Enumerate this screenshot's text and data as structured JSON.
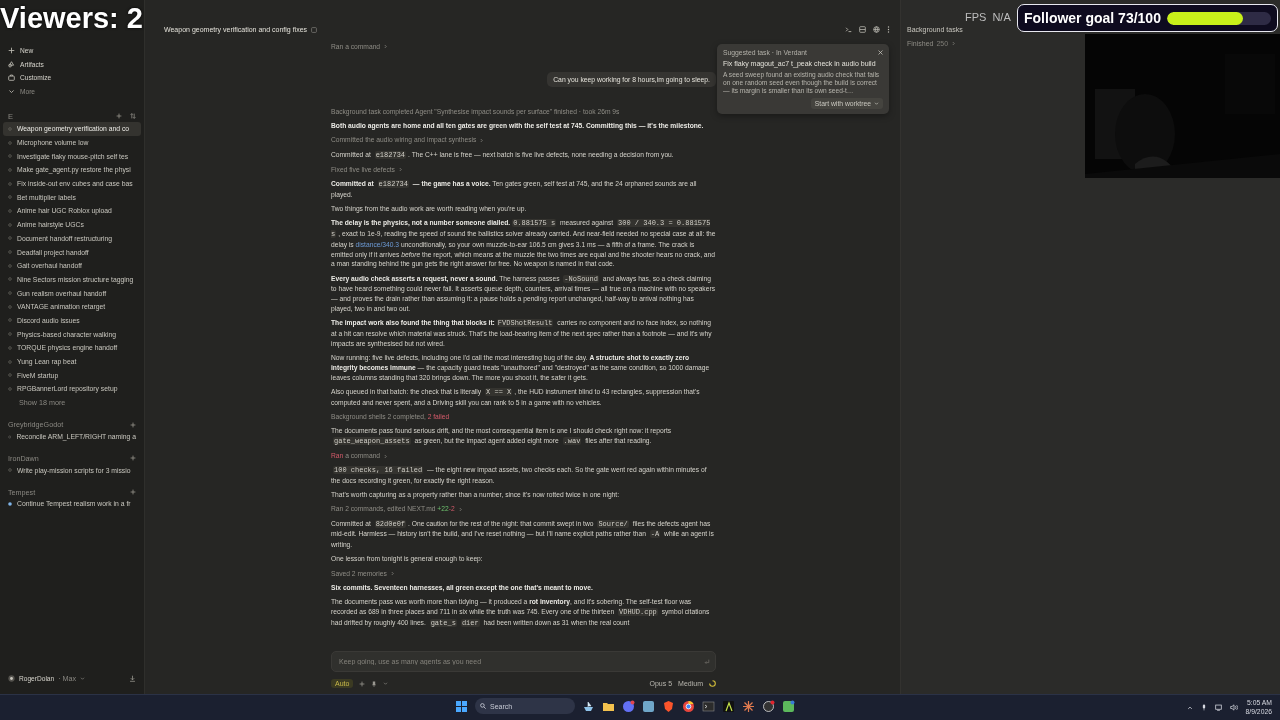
{
  "overlay": {
    "viewers": "Viewers: 2",
    "fps_label": "FPS",
    "fps_value": "N/A",
    "follower_goal": {
      "label": "Follower goal 73/100",
      "level": 0.73
    }
  },
  "sidebar": {
    "nav": [
      {
        "label": "New",
        "kind": "new"
      },
      {
        "label": "Artifacts",
        "kind": "artifacts"
      },
      {
        "label": "Customize",
        "kind": "customize"
      },
      {
        "label": "More",
        "kind": "more"
      }
    ],
    "section": "E",
    "chats": [
      {
        "title": "Weapon geometry verification and co",
        "selected": true
      },
      {
        "title": "Microphone volume low",
        "selected": false
      },
      {
        "title": "Investigate flaky mouse-pitch self tes",
        "selected": false
      },
      {
        "title": "Make gate_agent.py restore the physi",
        "selected": false
      },
      {
        "title": "Fix inside-out env cubes and case bas",
        "selected": false
      },
      {
        "title": "Bet multiplier labels",
        "selected": false
      },
      {
        "title": "Anime hair UGC Roblox upload",
        "selected": false
      },
      {
        "title": "Anime hairstyle UGCs",
        "selected": false
      },
      {
        "title": "Document handoff restructuring",
        "selected": false
      },
      {
        "title": "Deadfall project handoff",
        "selected": false
      },
      {
        "title": "Gait overhaul handoff",
        "selected": false
      },
      {
        "title": "Nine Sectors mission structure tagging",
        "selected": false
      },
      {
        "title": "Gun realism overhaul handoff",
        "selected": false
      },
      {
        "title": "VANTAGE animation retarget",
        "selected": false
      },
      {
        "title": "Discord audio issues",
        "selected": false
      },
      {
        "title": "Physics-based character walking",
        "selected": false
      },
      {
        "title": "TORQUE physics engine handoff",
        "selected": false
      },
      {
        "title": "Yung Lean rap beat",
        "selected": false
      },
      {
        "title": "FiveM startup",
        "selected": false
      },
      {
        "title": "RPGBannerLord repository setup",
        "selected": false
      }
    ],
    "show_more": "Show 18 more",
    "groups": [
      {
        "name": "GreybridgeGodot",
        "items": [
          {
            "title": "Reconcile ARM_LEFT/RIGHT naming a",
            "running": false
          }
        ]
      },
      {
        "name": "IronDawn",
        "items": [
          {
            "title": "Write play-mission scripts for 3 missio",
            "running": false
          }
        ]
      },
      {
        "name": "Tempest",
        "items": [
          {
            "title": "Continue Tempest realism work in a fr",
            "running": true
          }
        ]
      }
    ],
    "user": {
      "name": "RogerDolan",
      "plan": "· Max"
    }
  },
  "header": {
    "title": "Weapon geometry verification and config fixes"
  },
  "chat": {
    "blocks": [
      {
        "kind": "status",
        "expandable": true,
        "segments": [
          {
            "kind": "plain",
            "text": "Ran a command"
          }
        ]
      },
      {
        "kind": "user",
        "text": "Can you keep working for 8 hours,im going to sleep."
      },
      {
        "kind": "note",
        "text": "Background task completed Agent \"Synthesise impact sounds per surface\" finished · took 26m 9s"
      },
      {
        "kind": "paragraph",
        "segments": [
          {
            "kind": "bold",
            "text": "Both audio agents are home and all ten gates are green with the self test at 745. Committing this — it's the milestone."
          }
        ]
      },
      {
        "kind": "status",
        "expandable": true,
        "segments": [
          {
            "kind": "plain",
            "text": "Committed the audio wiring and impact synthesis"
          }
        ]
      },
      {
        "kind": "paragraph",
        "segments": [
          {
            "kind": "plain",
            "text": "Committed at "
          },
          {
            "kind": "code",
            "text": "e182734"
          },
          {
            "kind": "plain",
            "text": ". The C++ lane is free — next batch is five live defects, none needing a decision from you."
          }
        ]
      },
      {
        "kind": "status",
        "expandable": true,
        "segments": [
          {
            "kind": "plain",
            "text": "Fixed five live defects"
          }
        ]
      },
      {
        "kind": "paragraph",
        "segments": [
          {
            "kind": "bold",
            "text": "Committed at "
          },
          {
            "kind": "code",
            "text": "e182734"
          },
          {
            "kind": "bold",
            "text": " — the game has a voice."
          },
          {
            "kind": "plain",
            "text": " Ten gates green, self test at 745, and the 24 orphaned sounds are all played."
          }
        ]
      },
      {
        "kind": "paragraph",
        "segments": [
          {
            "kind": "plain",
            "text": "Two things from the audio work are worth reading when you're up."
          }
        ]
      },
      {
        "kind": "paragraph",
        "segments": [
          {
            "kind": "bold",
            "text": "The delay is the physics, not a number someone dialled."
          },
          {
            "kind": "code",
            "text": "0.881575 s"
          },
          {
            "kind": "plain",
            "text": " measured against "
          },
          {
            "kind": "code",
            "text": "300 / 340.3 = 0.881575 s"
          },
          {
            "kind": "plain",
            "text": ", exact to 1e-9, reading the speed of sound the ballistics solver already carried. And near-field needed no special case at all: the delay is "
          },
          {
            "kind": "link",
            "text": "distance/340.3"
          },
          {
            "kind": "plain",
            "text": " unconditionally, so your own muzzle-to-ear 106.5 cm gives 3.1 ms — a fifth of a frame. The crack is emitted only if it arrives "
          },
          {
            "kind": "italic",
            "text": "before"
          },
          {
            "kind": "plain",
            "text": " the report, which means at the muzzle the two times are equal and the shooter hears no crack, and a man standing behind the gun gets the right answer for free. No weapon is named in that code."
          }
        ]
      },
      {
        "kind": "paragraph",
        "segments": [
          {
            "kind": "bold",
            "text": "Every audio check asserts a request, never a sound."
          },
          {
            "kind": "plain",
            "text": " The harness passes "
          },
          {
            "kind": "code",
            "text": "-NoSound"
          },
          {
            "kind": "plain",
            "text": " and always has, so a check claiming to have heard something could never fail. It asserts queue depth, counters, arrival times — all true on a machine with no speakers — and proves the drain rather than assuming it: a pause holds a pending report unchanged, half-way to arrival nothing has played, two in and two out."
          }
        ]
      },
      {
        "kind": "paragraph",
        "segments": [
          {
            "kind": "bold",
            "text": "The impact work also found the thing that blocks it:"
          },
          {
            "kind": "code",
            "text": "FVDShotResult"
          },
          {
            "kind": "plain",
            "text": " carries no component and no face index, so nothing at a hit can resolve which material was struck. That's the load-bearing item of the next spec rather than a footnote — and it's why impacts are synthesised but not wired."
          }
        ]
      },
      {
        "kind": "paragraph",
        "segments": [
          {
            "kind": "plain",
            "text": "Now running: five live defects, including one I'd call the most interesting bug of the day. "
          },
          {
            "kind": "bold",
            "text": "A structure shot to exactly zero integrity becomes immune"
          },
          {
            "kind": "plain",
            "text": " — the capacity guard treats \"unauthored\" and \"destroyed\" as the same condition, so 1000 damage leaves columns standing that 320 brings down. The more you shoot it, the safer it gets."
          }
        ]
      },
      {
        "kind": "paragraph",
        "segments": [
          {
            "kind": "plain",
            "text": "Also queued in that batch: the check that is literally "
          },
          {
            "kind": "code",
            "text": "X == X"
          },
          {
            "kind": "plain",
            "text": ", the HUD instrument blind to 43 rectangles, suppression that's computed and never spent, and a Driving skill you can rank to 5 in a game with no vehicles."
          }
        ]
      },
      {
        "kind": "status",
        "expandable": false,
        "segments": [
          {
            "kind": "plain",
            "text": "Background shells 2 completed, "
          },
          {
            "kind": "red",
            "text": "2 failed"
          }
        ]
      },
      {
        "kind": "paragraph",
        "segments": [
          {
            "kind": "plain",
            "text": "The documents pass found serious drift, and the most consequential item is one I should check right now: it reports "
          },
          {
            "kind": "code",
            "text": "gate_weapon_assets"
          },
          {
            "kind": "plain",
            "text": " as green, but the impact agent added eight more "
          },
          {
            "kind": "code",
            "text": ".wav"
          },
          {
            "kind": "plain",
            "text": " files after that reading."
          }
        ]
      },
      {
        "kind": "status",
        "expandable": true,
        "segments": [
          {
            "kind": "red",
            "text": "Ran"
          },
          {
            "kind": "plain",
            "text": " a command"
          }
        ]
      },
      {
        "kind": "paragraph",
        "segments": [
          {
            "kind": "code",
            "text": "100 checks, 16 failed"
          },
          {
            "kind": "plain",
            "text": " — the eight new impact assets, two checks each. So the gate went red again within minutes of the docs recording it green, for exactly the right reason."
          }
        ]
      },
      {
        "kind": "paragraph",
        "segments": [
          {
            "kind": "plain",
            "text": "That's worth capturing as a property rather than a number, since it's now rotted twice in one night:"
          }
        ]
      },
      {
        "kind": "status",
        "expandable": true,
        "segments": [
          {
            "kind": "plain",
            "text": "Ran 2 commands, edited NEXT.md "
          },
          {
            "kind": "green",
            "text": "+22"
          },
          {
            "kind": "red",
            "text": "-2"
          }
        ]
      },
      {
        "kind": "paragraph",
        "segments": [
          {
            "kind": "plain",
            "text": "Committed at "
          },
          {
            "kind": "code",
            "text": "82d0e0f"
          },
          {
            "kind": "plain",
            "text": ". One caution for the rest of the night: that commit swept in two "
          },
          {
            "kind": "code",
            "text": "Source/"
          },
          {
            "kind": "plain",
            "text": " files the defects agent has mid-edit. Harmless — history isn't the build, and I've reset nothing — but I'll name explicit paths rather than "
          },
          {
            "kind": "code",
            "text": "-A"
          },
          {
            "kind": "plain",
            "text": " while an agent is writing."
          }
        ]
      },
      {
        "kind": "paragraph",
        "segments": [
          {
            "kind": "plain",
            "text": "One lesson from tonight is general enough to keep:"
          }
        ]
      },
      {
        "kind": "status",
        "expandable": true,
        "segments": [
          {
            "kind": "plain",
            "text": "Saved 2 memories"
          }
        ]
      },
      {
        "kind": "paragraph",
        "segments": [
          {
            "kind": "bold",
            "text": "Six commits. Seventeen harnesses, all green except the one that's meant to move."
          }
        ]
      },
      {
        "kind": "paragraph",
        "segments": [
          {
            "kind": "plain",
            "text": "The documents pass was worth more than tidying — it produced a "
          },
          {
            "kind": "bold",
            "text": "rot inventory"
          },
          {
            "kind": "plain",
            "text": ", and it's sobering. The self-test floor was recorded as 689 in three places and 711 in six while the truth was 745. Every one of the thirteen "
          },
          {
            "kind": "code",
            "text": "VDHUD.cpp"
          },
          {
            "kind": "plain",
            "text": " symbol citations had drifted by roughly 400 lines. "
          },
          {
            "kind": "code",
            "text": "gate_s"
          },
          {
            "kind": "code",
            "text": "dier"
          },
          {
            "kind": "plain",
            "text": " had been written down as 31 when the real count"
          }
        ]
      }
    ]
  },
  "composer": {
    "placeholder": "Keep going, use as many agents as you need",
    "mode": "Auto",
    "model": "Opus 5",
    "effort": "Medium"
  },
  "suggestion": {
    "header": "Suggested task · In Verdant",
    "title": "Fix flaky magout_ac7 t_peak check in audio build",
    "description": "A seed sweep found an existing audio check that fails on one random seed even though the build is correct — its margin is smaller than its own seed-t…",
    "action": "Start with worktree"
  },
  "background_tasks": {
    "title": "Background tasks",
    "finished_label": "Finished",
    "finished_count": "250"
  },
  "taskbar": {
    "search": "Search",
    "time": "5:05 AM",
    "date": "8/9/2026"
  }
}
